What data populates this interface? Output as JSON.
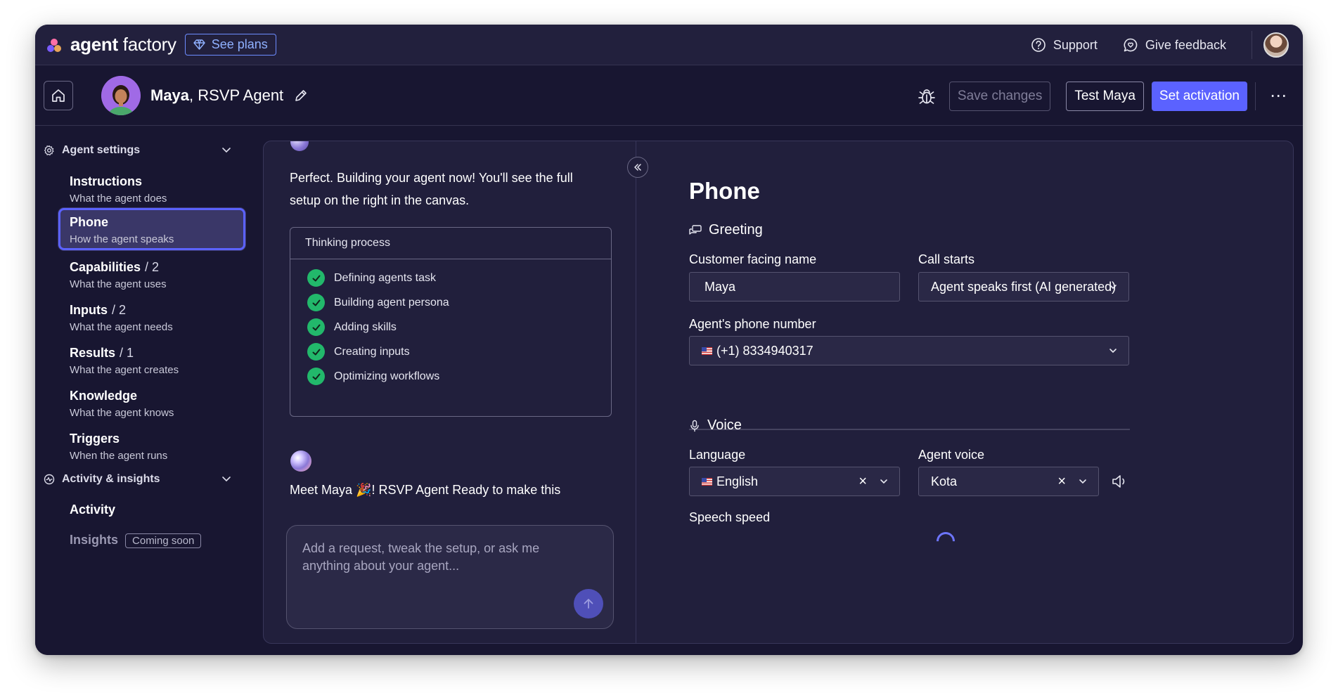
{
  "topbar": {
    "logo_bold": "agent",
    "logo_rest": " factory",
    "plans_label": "See plans",
    "support_label": "Support",
    "feedback_label": "Give feedback"
  },
  "agentbar": {
    "agent_name": "Maya",
    "agent_role": ", RSVP Agent",
    "save_label": "Save changes",
    "test_label": "Test Maya",
    "activate_label": "Set activation",
    "more_label": "⋯"
  },
  "sidebar": {
    "agent_settings_label": "Agent settings",
    "items": [
      {
        "title": "Instructions",
        "count": "",
        "subtitle": "What the agent does"
      },
      {
        "title": "Phone",
        "count": "",
        "subtitle": "How the agent speaks"
      },
      {
        "title": "Capabilities",
        "count": "/ 2",
        "subtitle": "What the agent uses"
      },
      {
        "title": "Inputs",
        "count": "/ 2",
        "subtitle": "What the agent needs"
      },
      {
        "title": "Results",
        "count": "/ 1",
        "subtitle": "What the agent creates"
      },
      {
        "title": "Knowledge",
        "count": "",
        "subtitle": "What the agent knows"
      },
      {
        "title": "Triggers",
        "count": "",
        "subtitle": "When the agent runs"
      }
    ],
    "activity_section_label": "Activity & insights",
    "activity_label": "Activity",
    "insights_label": "Insights",
    "coming_soon_label": "Coming soon"
  },
  "chat": {
    "message1": "Perfect. Building your agent now! You'll see the full setup on the right in the canvas.",
    "thinking_title": "Thinking process",
    "steps": [
      "Defining agents task",
      "Building agent persona",
      "Adding skills",
      "Creating inputs",
      "Optimizing workflows"
    ],
    "message2": "Meet Maya 🎉! RSVP Agent Ready to make this",
    "input_placeholder": "Add a request, tweak the setup, or ask me anything about your agent..."
  },
  "canvas": {
    "title": "Phone",
    "greeting_label": "Greeting",
    "customer_name_label": "Customer facing name",
    "customer_name_value": "Maya",
    "call_starts_label": "Call starts",
    "call_starts_value": "Agent speaks first (AI generated)",
    "phone_label": "Agent's phone number",
    "phone_value": "(+1) 8334940317",
    "voice_label": "Voice",
    "language_label": "Language",
    "language_value": "English",
    "agent_voice_label": "Agent voice",
    "agent_voice_value": "Kota",
    "speech_speed_label": "Speech speed"
  },
  "colors": {
    "accent": "#5b62ff",
    "background": "#181631",
    "panel": "#211f3c",
    "success": "#22b86b"
  }
}
